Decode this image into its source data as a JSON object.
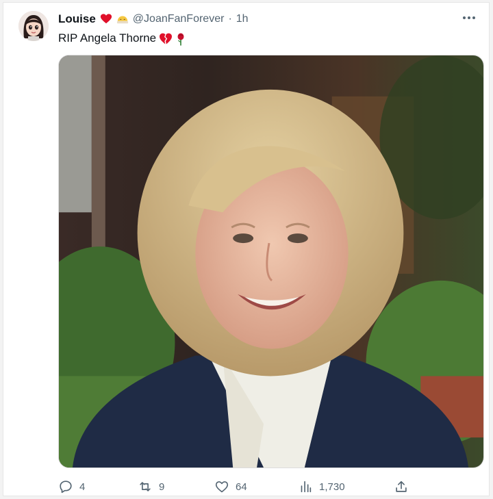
{
  "tweet": {
    "display_name": "Louise",
    "name_emojis": [
      "red-heart",
      "sleepy-face"
    ],
    "handle": "@JoanFanForever",
    "separator": "·",
    "timestamp": "1h",
    "text": "RIP Angela Thorne",
    "text_emojis": [
      "broken-heart",
      "rose"
    ],
    "media": {
      "description_icon": "photo"
    },
    "actions": {
      "replies": "4",
      "retweets": "9",
      "likes": "64",
      "views": "1,730"
    }
  },
  "colors": {
    "text_primary": "#0f1419",
    "text_secondary": "#536471",
    "heart_red": "#f91880"
  }
}
